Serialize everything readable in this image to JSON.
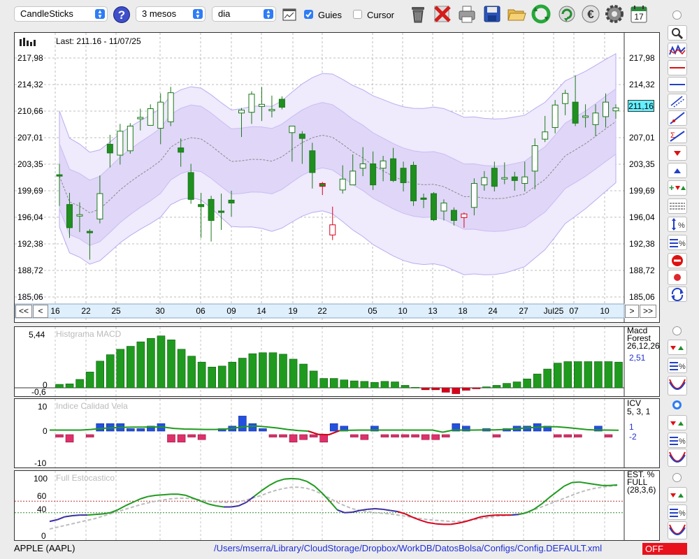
{
  "toolbar": {
    "chart_type": "CandleSticks",
    "period": "3 mesos",
    "interval": "dia",
    "guides_label": "Guies",
    "guides_checked": true,
    "cursor_label": "Cursor",
    "cursor_checked": false,
    "icons": [
      "help-icon",
      "chart-window-icon",
      "trash-icon",
      "delete-icon",
      "print-icon",
      "save-icon",
      "open-folder-icon",
      "refresh-icon",
      "rotate-icon",
      "euro-icon",
      "settings-icon",
      "calendar-icon"
    ],
    "calendar_day": "17"
  },
  "main_chart": {
    "last_label": "Last: 211.16 - 11/07/25",
    "y_ticks": [
      "217,98",
      "214,32",
      "210,66",
      "207,01",
      "203,35",
      "199,69",
      "196,04",
      "192,38",
      "188,72",
      "185,06"
    ],
    "current_price": "211,16",
    "x_labels": [
      "16",
      "22",
      "25",
      "30",
      "06",
      "09",
      "14",
      "19",
      "22",
      "05",
      "10",
      "13",
      "18",
      "24",
      "27",
      "Jul25",
      "07",
      "10"
    ],
    "nav": {
      "first": "<<",
      "prev": "<",
      "next": ">",
      "last": ">>"
    }
  },
  "macd_panel": {
    "title": "Histgrama MACD",
    "y_top": "5,44",
    "y_zero": "0",
    "y_bottom": "-0,6",
    "legend": [
      "Macd",
      "Forest",
      "26,12,26"
    ],
    "value": "2,51"
  },
  "icv_panel": {
    "title": "Indice Calidad Vela",
    "y_top": "10",
    "y_zero": "0",
    "y_bottom": "-10",
    "legend": [
      "ICV",
      "5, 3, 1"
    ],
    "value_pos": "1",
    "value_neg": "-2"
  },
  "stoch_panel": {
    "title": "Full Estocastico",
    "y_ticks": [
      "100",
      "60",
      "40",
      "0"
    ],
    "legend": [
      "EST. %",
      "FULL",
      "(28,3,6)"
    ]
  },
  "status": {
    "symbol": "APPLE (AAPL)",
    "path": "/Users/mserra/Library/CloudStorage/Dropbox/WorkDB/DatosBolsa/Configs/Config.DEFAULT.xml",
    "off_label": "OFF"
  },
  "colors": {
    "up": "#ffffff",
    "down": "#1f8f1f",
    "red": "#d9001b",
    "band": "#e4dcf8",
    "blue_bar": "#2450e0",
    "pink_bar": "#e0306a",
    "off_bg": "#e8121d"
  },
  "chart_data": [
    {
      "type": "candlestick",
      "title": "",
      "ylim": [
        185.06,
        219.5
      ],
      "candles": [
        {
          "date": "16",
          "o": 201.9,
          "h": 203.4,
          "l": 197.6,
          "c": 201.7
        },
        {
          "date": "",
          "o": 197.8,
          "h": 199.4,
          "l": 193.2,
          "c": 194.6
        },
        {
          "date": "",
          "o": 196.2,
          "h": 198.1,
          "l": 194.0,
          "c": 196.4
        },
        {
          "date": "",
          "o": 194.1,
          "h": 194.4,
          "l": 190.2,
          "c": 193.9
        },
        {
          "date": "22",
          "o": 195.8,
          "h": 201.8,
          "l": 195.2,
          "c": 199.3
        },
        {
          "date": "",
          "o": 206.1,
          "h": 207.4,
          "l": 202.9,
          "c": 204.9
        },
        {
          "date": "",
          "o": 204.6,
          "h": 208.9,
          "l": 203.3,
          "c": 207.9
        },
        {
          "date": "25",
          "o": 205.2,
          "h": 209.0,
          "l": 204.8,
          "c": 208.6
        },
        {
          "date": "",
          "o": 209.6,
          "h": 211.0,
          "l": 208.0,
          "c": 209.8
        },
        {
          "date": "",
          "o": 208.7,
          "h": 211.6,
          "l": 208.7,
          "c": 211.0
        },
        {
          "date": "30",
          "o": 208.3,
          "h": 213.1,
          "l": 206.1,
          "c": 211.9
        },
        {
          "date": "",
          "o": 209.2,
          "h": 214.0,
          "l": 208.6,
          "c": 213.2
        },
        {
          "date": "",
          "o": 205.6,
          "h": 206.9,
          "l": 203.0,
          "c": 205.0
        },
        {
          "date": "06",
          "o": 202.2,
          "h": 203.4,
          "l": 197.9,
          "c": 198.5
        },
        {
          "date": "",
          "o": 197.8,
          "h": 199.4,
          "l": 193.2,
          "c": 197.5
        },
        {
          "date": "09",
          "o": 198.5,
          "h": 199.0,
          "l": 192.7,
          "c": 195.6
        },
        {
          "date": "",
          "o": 196.9,
          "h": 199.3,
          "l": 194.3,
          "c": 196.7
        },
        {
          "date": "",
          "o": 198.4,
          "h": 199.7,
          "l": 196.1,
          "c": 198.0
        },
        {
          "date": "14",
          "o": 210.4,
          "h": 211.1,
          "l": 207.1,
          "c": 210.8
        },
        {
          "date": "",
          "o": 210.5,
          "h": 213.4,
          "l": 208.9,
          "c": 213.0
        },
        {
          "date": "",
          "o": 211.3,
          "h": 214.0,
          "l": 209.3,
          "c": 211.6
        },
        {
          "date": "19",
          "o": 210.8,
          "h": 212.8,
          "l": 209.8,
          "c": 210.9
        },
        {
          "date": "",
          "o": 212.3,
          "h": 212.7,
          "l": 210.9,
          "c": 211.2
        },
        {
          "date": "",
          "o": 207.7,
          "h": 208.4,
          "l": 203.7,
          "c": 208.6
        },
        {
          "date": "22",
          "o": 207.5,
          "h": 207.9,
          "l": 203.4,
          "c": 206.9
        },
        {
          "date": "",
          "o": 205.2,
          "h": 206.3,
          "l": 200.0,
          "c": 202.2
        },
        {
          "date": "",
          "o": 200.7,
          "h": 200.9,
          "l": 199.1,
          "c": 200.3
        },
        {
          "date": "",
          "o": 193.6,
          "h": 197.5,
          "l": 192.9,
          "c": 195.0
        },
        {
          "date": "05",
          "o": 199.8,
          "h": 203.2,
          "l": 199.3,
          "c": 201.3
        },
        {
          "date": "",
          "o": 200.5,
          "h": 204.7,
          "l": 200.7,
          "c": 202.4
        },
        {
          "date": "",
          "o": 202.8,
          "h": 205.7,
          "l": 201.7,
          "c": 203.4
        },
        {
          "date": "10",
          "o": 203.4,
          "h": 205.1,
          "l": 199.8,
          "c": 200.5
        },
        {
          "date": "",
          "o": 202.8,
          "h": 204.5,
          "l": 201.0,
          "c": 203.8
        },
        {
          "date": "",
          "o": 204.1,
          "h": 205.6,
          "l": 200.9,
          "c": 201.1
        },
        {
          "date": "13",
          "o": 202.8,
          "h": 203.7,
          "l": 199.6,
          "c": 200.8
        },
        {
          "date": "",
          "o": 203.2,
          "h": 203.7,
          "l": 197.6,
          "c": 198.3
        },
        {
          "date": "",
          "o": 198.7,
          "h": 199.3,
          "l": 197.3,
          "c": 198.5
        },
        {
          "date": "18",
          "o": 199.3,
          "h": 199.5,
          "l": 195.5,
          "c": 195.7
        },
        {
          "date": "",
          "o": 196.9,
          "h": 198.5,
          "l": 195.6,
          "c": 198.0
        },
        {
          "date": "",
          "o": 197.0,
          "h": 197.4,
          "l": 194.9,
          "c": 195.6
        },
        {
          "date": "24",
          "o": 196.0,
          "h": 196.7,
          "l": 194.6,
          "c": 196.5
        },
        {
          "date": "",
          "o": 197.4,
          "h": 201.4,
          "l": 196.3,
          "c": 200.7
        },
        {
          "date": "",
          "o": 200.5,
          "h": 202.4,
          "l": 199.7,
          "c": 201.5
        },
        {
          "date": "27",
          "o": 202.8,
          "h": 203.7,
          "l": 199.6,
          "c": 200.3
        },
        {
          "date": "",
          "o": 201.4,
          "h": 203.6,
          "l": 200.6,
          "c": 201.5
        },
        {
          "date": "",
          "o": 201.6,
          "h": 202.3,
          "l": 199.7,
          "c": 201.1
        },
        {
          "date": "",
          "o": 200.7,
          "h": 203.7,
          "l": 199.6,
          "c": 201.6
        },
        {
          "date": "Jul25",
          "o": 202.4,
          "h": 206.9,
          "l": 199.9,
          "c": 205.9
        },
        {
          "date": "",
          "o": 206.8,
          "h": 210.0,
          "l": 206.4,
          "c": 207.8
        },
        {
          "date": "",
          "o": 208.4,
          "h": 212.2,
          "l": 207.6,
          "c": 211.5
        },
        {
          "date": "",
          "o": 211.7,
          "h": 213.6,
          "l": 210.1,
          "c": 213.1
        },
        {
          "date": "07",
          "o": 211.9,
          "h": 215.6,
          "l": 208.6,
          "c": 209.0
        },
        {
          "date": "",
          "o": 210.0,
          "h": 211.6,
          "l": 208.4,
          "c": 210.0
        },
        {
          "date": "",
          "o": 208.8,
          "h": 211.6,
          "l": 207.2,
          "c": 210.4
        },
        {
          "date": "10",
          "o": 209.9,
          "h": 213.1,
          "l": 208.4,
          "c": 211.9
        },
        {
          "date": "",
          "o": 210.7,
          "h": 211.6,
          "l": 209.6,
          "c": 211.1
        }
      ],
      "bollinger_upper_start": 211.0,
      "bollinger_lower_start": 186.0
    },
    {
      "type": "bar",
      "title": "Histgrama MACD",
      "ylim": [
        -0.6,
        5.44
      ],
      "values": [
        0.35,
        0.4,
        0.85,
        1.6,
        2.7,
        3.35,
        3.9,
        4.2,
        4.65,
        5.0,
        5.25,
        4.85,
        3.9,
        3.2,
        2.6,
        2.1,
        2.2,
        2.6,
        3.0,
        3.45,
        3.55,
        3.55,
        3.4,
        2.9,
        2.4,
        1.7,
        0.95,
        0.95,
        0.8,
        0.7,
        0.65,
        0.55,
        0.65,
        0.6,
        0.25,
        0.05,
        -0.2,
        -0.2,
        -0.45,
        -0.6,
        -0.25,
        -0.1,
        0.1,
        0.25,
        0.45,
        0.6,
        0.9,
        1.4,
        1.9,
        2.5,
        2.65,
        2.65,
        2.65,
        2.65,
        2.65,
        2.6
      ]
    },
    {
      "type": "bar",
      "title": "Indice Calidad Vela",
      "ylim": [
        -10,
        10
      ],
      "values": [
        -1,
        -3,
        0,
        -1,
        3,
        3,
        3,
        1,
        1,
        2,
        3,
        -3,
        -3,
        -1,
        -2,
        0,
        1,
        2,
        6,
        3,
        1,
        -1,
        -1,
        -3,
        -2,
        -1,
        -3,
        3,
        2,
        -1,
        -2,
        2,
        -1,
        -1,
        -1,
        -1,
        -2,
        -2,
        -1,
        3,
        2,
        0,
        1,
        -1,
        1,
        2,
        2,
        3,
        2,
        -1,
        -1,
        -1,
        0,
        2,
        -1,
        0
      ],
      "line": [
        0.5,
        0.5,
        0.5,
        0.5,
        0.8,
        1.3,
        1.6,
        1.8,
        1.9,
        1.9,
        2.0,
        1.9,
        1.3,
        1.0,
        0.9,
        0.8,
        0.8,
        1.0,
        1.6,
        2.2,
        2.4,
        2.0,
        1.5,
        0.8,
        0.3,
        0.0,
        -1.6,
        -1.7,
        0.2,
        0.4,
        0.5,
        0.5,
        0.5,
        0.5,
        0.5,
        0.5,
        0.5,
        0.5,
        -0.5,
        0.5,
        0.5,
        0.5,
        0.6,
        0.6,
        0.8,
        1.1,
        1.5,
        1.8,
        2.1,
        2.1,
        1.7,
        1.2,
        0.7,
        0.5,
        0.5,
        0.4
      ],
      "legend": [
        "1",
        "-2"
      ]
    },
    {
      "type": "line",
      "title": "Full Estocastico",
      "ylim": [
        0,
        100
      ],
      "series": [
        {
          "values": [
            25,
            28,
            33,
            35,
            36,
            36,
            37,
            38,
            40,
            45,
            52,
            58,
            64,
            68,
            70,
            71,
            72,
            72,
            70,
            65,
            60,
            55,
            52,
            50,
            50,
            52,
            58,
            68,
            78,
            87,
            94,
            98,
            99,
            98,
            94,
            86,
            74,
            60,
            45,
            40,
            41,
            44,
            46,
            47,
            46,
            44,
            42,
            38,
            32,
            27,
            23,
            21,
            20,
            20,
            22,
            25,
            29,
            33,
            35,
            36,
            36,
            36,
            37,
            40,
            46,
            55,
            66,
            76,
            86,
            92,
            93,
            91,
            89,
            87,
            87,
            88
          ]
        },
        {
          "values": [
            12,
            15,
            18,
            21,
            24,
            27,
            30,
            34,
            38,
            42,
            46,
            50,
            54,
            57,
            60,
            62,
            64,
            65,
            65,
            64,
            62,
            60,
            59,
            58,
            58,
            59,
            62,
            66,
            70,
            75,
            79,
            82,
            84,
            84,
            82,
            78,
            72,
            65,
            58,
            52,
            47,
            44,
            42,
            40,
            39,
            38,
            36,
            34,
            32,
            30,
            28,
            27,
            26,
            25,
            25,
            26,
            28,
            30,
            32,
            34,
            35,
            36,
            38,
            41,
            45,
            50,
            55,
            60,
            65,
            70,
            75,
            79,
            82,
            84,
            86,
            87
          ]
        }
      ]
    }
  ]
}
